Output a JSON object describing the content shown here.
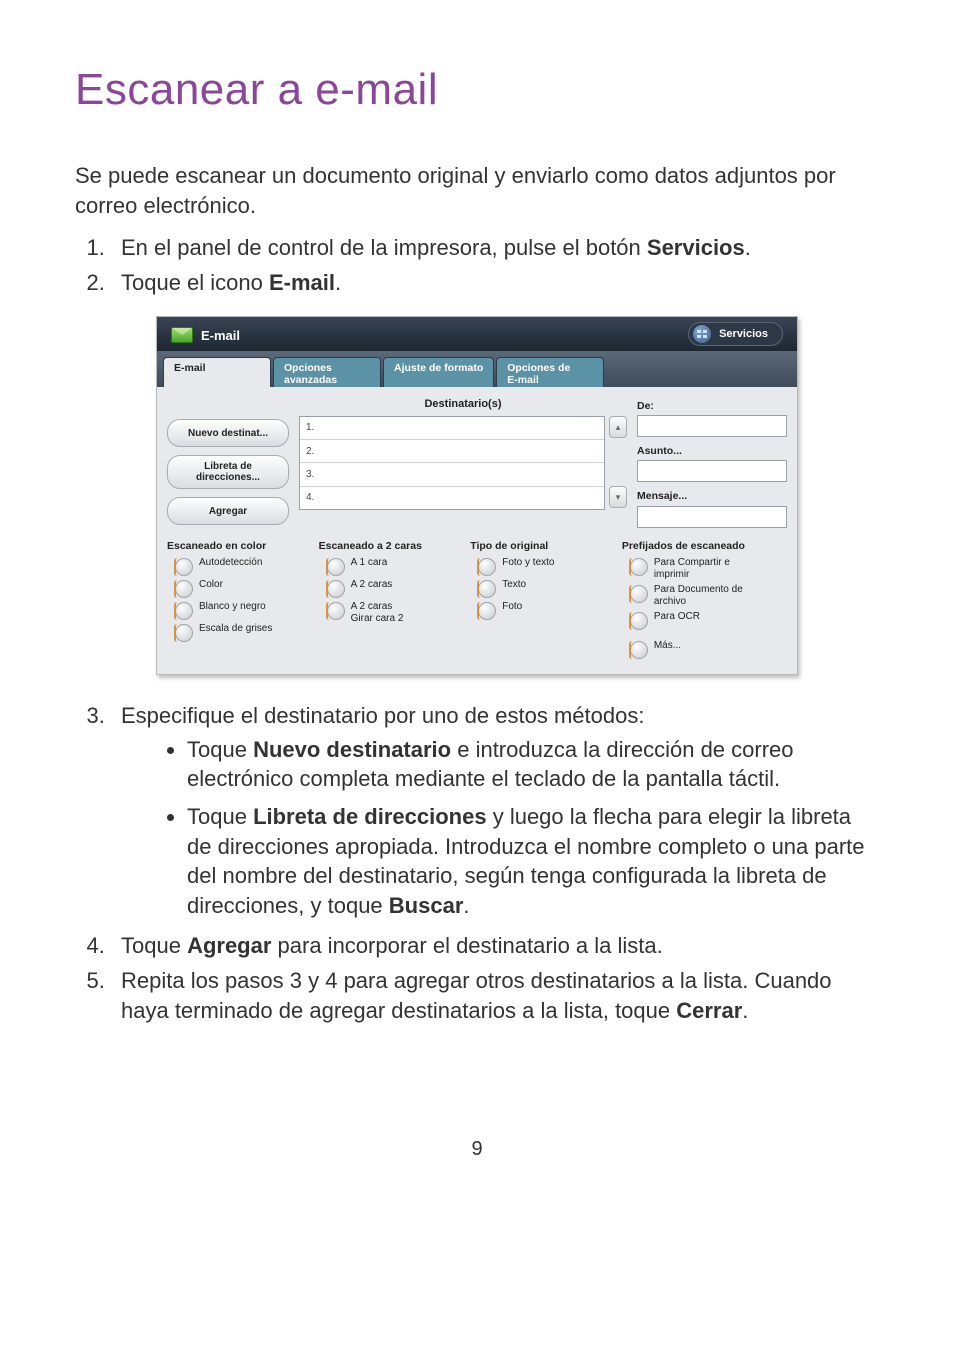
{
  "page": {
    "title": "Escanear a e-mail",
    "intro": "Se puede escanear un documento original y enviarlo como datos adjuntos por correo electrónico.",
    "page_number": "9"
  },
  "steps": {
    "s1_pre": "En el panel de control de la impresora, pulse el botón ",
    "s1_bold": "Servicios",
    "s1_post": ".",
    "s2_pre": "Toque el icono ",
    "s2_bold": "E-mail",
    "s2_post": ".",
    "s3": "Especifique el destinatario por uno de estos métodos:",
    "s3a_pre": "Toque ",
    "s3a_bold": "Nuevo destinatario",
    "s3a_post": " e introduzca la dirección de correo electrónico completa mediante el teclado de la pantalla táctil.",
    "s3b_pre": "Toque ",
    "s3b_bold": "Libreta de direcciones",
    "s3b_mid": " y luego la flecha para elegir la libreta de direcciones apropiada. Introduzca el nombre completo o una parte del nombre del destinatario, según tenga configurada la libreta de direcciones, y toque ",
    "s3b_bold2": "Buscar",
    "s3b_post": ".",
    "s4_pre": "Toque ",
    "s4_bold": "Agregar",
    "s4_post": " para incorporar el destinatario a la lista.",
    "s5_pre": "Repita los pasos 3 y 4 para agregar otros destinatarios a la lista. Cuando haya terminado de agregar destinatarios a la lista, toque ",
    "s5_bold": "Cerrar",
    "s5_post": "."
  },
  "panel": {
    "title": "E-mail",
    "services": "Servicios",
    "tabs": {
      "t1": "E-mail",
      "t2": "Opciones\navanzadas",
      "t3": "Ajuste de formato",
      "t4": "Opciones de\nE-mail"
    },
    "buttons": {
      "new": "Nuevo destinat...",
      "addrbook": "Libreta de\ndirecciones...",
      "add": "Agregar"
    },
    "list": {
      "header": "Destinatario(s)",
      "r1": "1.",
      "r2": "2.",
      "r3": "3.",
      "r4": "4."
    },
    "scroll": {
      "up": "▴",
      "down": "▾"
    },
    "fields": {
      "from": "De:",
      "subject": "Asunto...",
      "message": "Mensaje..."
    },
    "groups": {
      "color": {
        "title": "Escaneado en color",
        "o1": "Autodetección",
        "o2": "Color",
        "o3": "Blanco y negro",
        "o4": "Escala de grises"
      },
      "sides": {
        "title": "Escaneado a 2 caras",
        "o1": "A 1 cara",
        "o2": "A 2 caras",
        "o3": "A 2 caras\nGirar cara 2"
      },
      "orig": {
        "title": "Tipo de original",
        "o1": "Foto y texto",
        "o2": "Texto",
        "o3": "Foto"
      },
      "preset": {
        "title": "Prefijados de escaneado",
        "o1": "Para Compartir e\nimprimir",
        "o2": "Para Documento de\narchivo",
        "o3": "Para OCR",
        "more": "Más..."
      }
    }
  }
}
